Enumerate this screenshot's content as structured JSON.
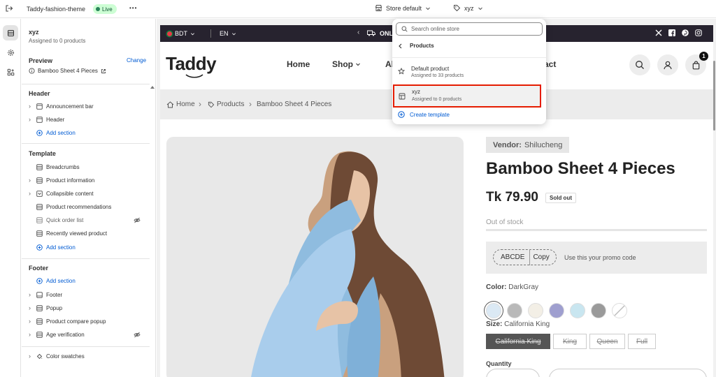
{
  "topbar": {
    "theme_name": "Taddy-fashion-theme",
    "live_badge": "Live",
    "more": "•••",
    "store_selector": "Store default",
    "template_selector": "xyz"
  },
  "sidebar": {
    "template_name": "xyz",
    "template_sub": "Assigned to 0 products",
    "preview_label": "Preview",
    "change_link": "Change",
    "preview_product": "Bamboo Sheet 4 Pieces",
    "header_title": "Header",
    "header_items": [
      "Announcement bar",
      "Header"
    ],
    "add_section": "Add section",
    "template_title": "Template",
    "template_items": [
      "Breadcrumbs",
      "Product information",
      "Collapsible content",
      "Product recommendations",
      "Quick order list",
      "Recently viewed product"
    ],
    "footer_title": "Footer",
    "footer_items": [
      "Footer",
      "Popup",
      "Product compare popup",
      "Age verification"
    ],
    "bottom_item": "Color swatches"
  },
  "store": {
    "currency": "BDT",
    "language": "EN",
    "announcement": "ONL",
    "logo": "Taddy",
    "nav": [
      "Home",
      "Shop",
      "Al",
      "act"
    ],
    "cart_count": "1",
    "breadcrumb": [
      "Home",
      "Products",
      "Bamboo Sheet 4 Pieces"
    ],
    "vendor_label": "Vendor:",
    "vendor_value": "Shilucheng",
    "product_title": "Bamboo Sheet 4 Pieces",
    "price": "Tk 79.90",
    "sold_out": "Sold out",
    "stock": "Out of stock",
    "promo_code": "ABCDE",
    "copy": "Copy",
    "promo_text": "Use this your promo code",
    "color_label": "Color:",
    "color_value": "DarkGray",
    "size_label": "Size:",
    "size_value": "California King",
    "sizes": [
      "California King",
      "King",
      "Queen",
      "Full"
    ],
    "quantity": "Quantity"
  },
  "dropdown": {
    "search_placeholder": "Search online store",
    "back_label": "Products",
    "items": [
      {
        "title": "Default product",
        "sub": "Assigned to 33 products"
      },
      {
        "title": "xyz",
        "sub": "Assigned to 0 products"
      }
    ],
    "create": "Create template"
  },
  "colors": {
    "accent": "#005bd3",
    "live_bg": "#cdfed4",
    "live_text": "#0c5132",
    "highlight": "#e51c00",
    "annbar": "#27232f"
  },
  "swatches": [
    "#dbe9f4",
    "#b9b9b9",
    "#f3efe6",
    "#9f9fcf",
    "#c9e6f0",
    "#9a9a9a",
    "#ffffff"
  ]
}
